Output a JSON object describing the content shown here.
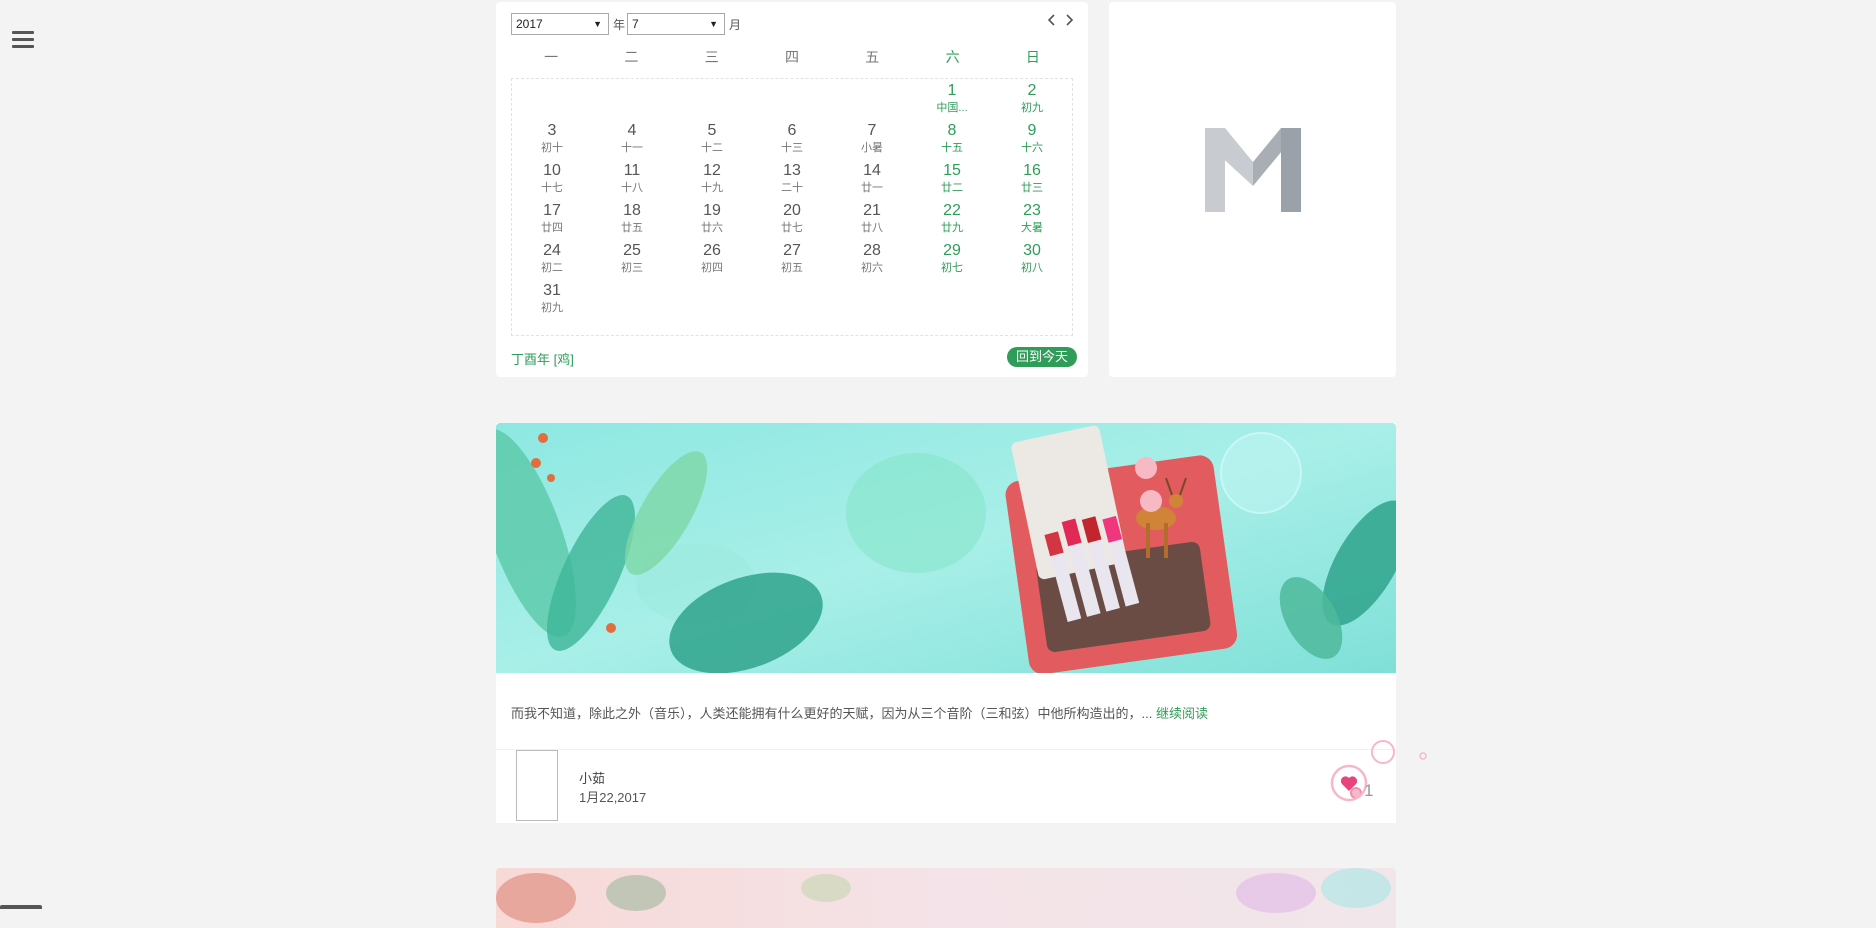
{
  "nav": {
    "menu_icon": "hamburger-icon"
  },
  "calendar": {
    "year_value": "2017",
    "year_suffix": "年",
    "month_value": "7",
    "month_suffix": "月",
    "prev_icon": "chevron-left-icon",
    "next_icon": "chevron-right-icon",
    "weekdays": [
      "一",
      "二",
      "三",
      "四",
      "五",
      "六",
      "日"
    ],
    "days": [
      {
        "d": "",
        "l": ""
      },
      {
        "d": "",
        "l": ""
      },
      {
        "d": "",
        "l": ""
      },
      {
        "d": "",
        "l": ""
      },
      {
        "d": "",
        "l": ""
      },
      {
        "d": "1",
        "l": "中国..."
      },
      {
        "d": "2",
        "l": "初九"
      },
      {
        "d": "3",
        "l": "初十"
      },
      {
        "d": "4",
        "l": "十一"
      },
      {
        "d": "5",
        "l": "十二"
      },
      {
        "d": "6",
        "l": "十三"
      },
      {
        "d": "7",
        "l": "小暑"
      },
      {
        "d": "8",
        "l": "十五"
      },
      {
        "d": "9",
        "l": "十六"
      },
      {
        "d": "10",
        "l": "十七"
      },
      {
        "d": "11",
        "l": "十八"
      },
      {
        "d": "12",
        "l": "十九"
      },
      {
        "d": "13",
        "l": "二十"
      },
      {
        "d": "14",
        "l": "廿一"
      },
      {
        "d": "15",
        "l": "廿二"
      },
      {
        "d": "16",
        "l": "廿三"
      },
      {
        "d": "17",
        "l": "廿四"
      },
      {
        "d": "18",
        "l": "廿五"
      },
      {
        "d": "19",
        "l": "廿六"
      },
      {
        "d": "20",
        "l": "廿七"
      },
      {
        "d": "21",
        "l": "廿八"
      },
      {
        "d": "22",
        "l": "廿九"
      },
      {
        "d": "23",
        "l": "大暑"
      },
      {
        "d": "24",
        "l": "初二"
      },
      {
        "d": "25",
        "l": "初三"
      },
      {
        "d": "26",
        "l": "初四"
      },
      {
        "d": "27",
        "l": "初五"
      },
      {
        "d": "28",
        "l": "初六"
      },
      {
        "d": "29",
        "l": "初七"
      },
      {
        "d": "30",
        "l": "初八"
      },
      {
        "d": "31",
        "l": "初九"
      }
    ],
    "lunar_year": "丁酉年 [鸡]",
    "today_button": "回到今天",
    "accent_color": "#2f9d59"
  },
  "logo": {
    "icon": "m-logo-icon"
  },
  "post": {
    "excerpt": "而我不知道，除此之外（音乐），人类还能拥有什么更好的天赋，因为从三个音阶（三和弦）中他所构造出的，...",
    "read_more": "继续阅读",
    "author": "小茹",
    "date": "1月22,2017",
    "like_count": "1",
    "like_icon": "heart-icon"
  }
}
